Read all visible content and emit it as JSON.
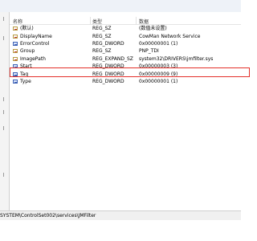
{
  "list": {
    "headers": {
      "name": "名称",
      "type": "类型",
      "data": "数据"
    },
    "rows": [
      {
        "icon": "string-value-icon",
        "name": "(默认)",
        "type": "REG_SZ",
        "data": "(数值未设置)"
      },
      {
        "icon": "string-value-icon",
        "name": "DisplayName",
        "type": "REG_SZ",
        "data": "CowMan Network Service"
      },
      {
        "icon": "dword-value-icon",
        "name": "ErrorControl",
        "type": "REG_DWORD",
        "data": "0x00000001 (1)"
      },
      {
        "icon": "string-value-icon",
        "name": "Group",
        "type": "REG_SZ",
        "data": "PNP_TDI"
      },
      {
        "icon": "string-value-icon",
        "name": "ImagePath",
        "type": "REG_EXPAND_SZ",
        "data": "system32\\DRIVERS\\jmfilter.sys"
      },
      {
        "icon": "dword-value-icon",
        "name": "Start",
        "type": "REG_DWORD",
        "data": "0x00000003 (3)"
      },
      {
        "icon": "dword-value-icon",
        "name": "Tag",
        "type": "REG_DWORD",
        "data": "0x00000009 (9)"
      },
      {
        "icon": "dword-value-icon",
        "name": "Type",
        "type": "REG_DWORD",
        "data": "0x00000001 (1)"
      }
    ],
    "highlighted_row": "Start",
    "highlight_color": "#e3312b"
  },
  "status_bar": {
    "path": "SYSTEM\\ControlSet002\\services\\JMFilter"
  }
}
